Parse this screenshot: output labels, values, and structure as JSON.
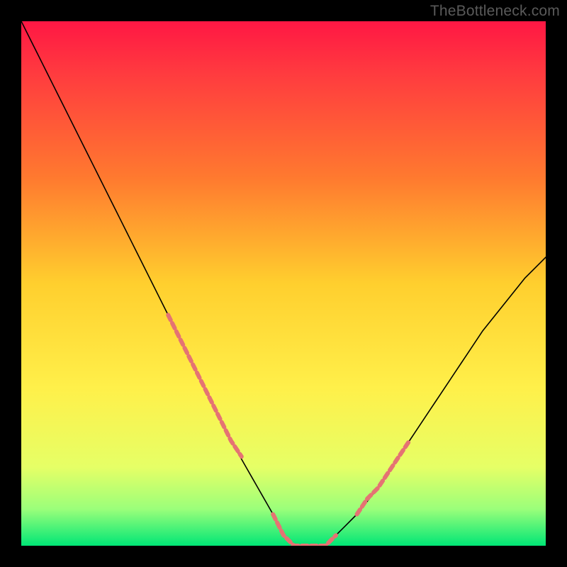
{
  "watermark": "TheBottleneck.com",
  "chart_data": {
    "type": "line",
    "title": "",
    "xlabel": "",
    "ylabel": "",
    "xlim": [
      0,
      100
    ],
    "ylim": [
      0,
      100
    ],
    "background_gradient": {
      "stops": [
        {
          "offset": 0.0,
          "color": "#ff1744"
        },
        {
          "offset": 0.1,
          "color": "#ff3b3f"
        },
        {
          "offset": 0.3,
          "color": "#ff7a2f"
        },
        {
          "offset": 0.5,
          "color": "#ffcf2e"
        },
        {
          "offset": 0.7,
          "color": "#fff04a"
        },
        {
          "offset": 0.85,
          "color": "#e6ff66"
        },
        {
          "offset": 0.93,
          "color": "#9bff7a"
        },
        {
          "offset": 1.0,
          "color": "#00e676"
        }
      ]
    },
    "curve": {
      "x": [
        0,
        4,
        8,
        12,
        16,
        20,
        24,
        28,
        32,
        36,
        40,
        44,
        48,
        50,
        52,
        54,
        56,
        58,
        60,
        64,
        68,
        72,
        76,
        80,
        84,
        88,
        92,
        96,
        100
      ],
      "y": [
        100,
        92,
        84,
        76,
        68,
        60,
        52,
        44,
        36,
        28,
        20,
        13,
        6,
        2,
        0,
        0,
        0,
        0,
        2,
        6,
        11,
        17,
        23,
        29,
        35,
        41,
        46,
        51,
        55
      ],
      "stroke": "#000000",
      "stroke_width": 1.6
    },
    "dash_overlays": [
      {
        "x": [
          28,
          30,
          32,
          34,
          36,
          38,
          40,
          42
        ],
        "y": [
          44,
          40,
          36,
          32,
          28,
          24,
          20,
          17
        ],
        "color": "#e57373",
        "stroke_width": 6,
        "dash": [
          8,
          5
        ]
      },
      {
        "x": [
          48,
          50,
          52,
          54,
          56,
          58,
          60
        ],
        "y": [
          6,
          2,
          0,
          0,
          0,
          0,
          2
        ],
        "color": "#e57373",
        "stroke_width": 6,
        "dash": [
          8,
          5
        ]
      },
      {
        "x": [
          64,
          66,
          68,
          70,
          72,
          74
        ],
        "y": [
          6,
          9,
          11,
          14,
          17,
          20
        ],
        "color": "#e57373",
        "stroke_width": 6,
        "dash": [
          8,
          5
        ]
      }
    ]
  }
}
